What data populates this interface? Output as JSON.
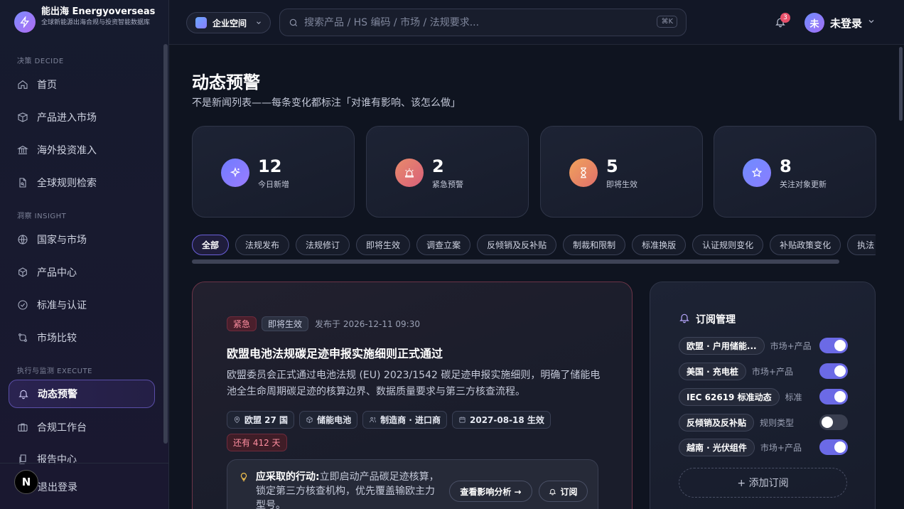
{
  "brand": {
    "name": "能出海 Energyoverseas",
    "subtitle": "全球新能源出海合规与投资智能数据库"
  },
  "sidebar": {
    "sections": [
      {
        "label": "决策 DECIDE"
      },
      {
        "label": "洞察 INSIGHT"
      },
      {
        "label": "执行与监测 EXECUTE"
      }
    ],
    "items": [
      {
        "label": "首页",
        "icon": "home-icon"
      },
      {
        "label": "产品进入市场",
        "icon": "box-icon"
      },
      {
        "label": "海外投资准入",
        "icon": "bank-icon"
      },
      {
        "label": "全球规则检索",
        "icon": "doc-search-icon"
      },
      {
        "label": "国家与市场",
        "icon": "globe-icon"
      },
      {
        "label": "产品中心",
        "icon": "cube-icon"
      },
      {
        "label": "标准与认证",
        "icon": "check-circle-icon"
      },
      {
        "label": "市场比较",
        "icon": "compare-icon"
      },
      {
        "label": "动态预警",
        "icon": "bell-icon",
        "active": true
      },
      {
        "label": "合规工作台",
        "icon": "briefcase-icon"
      },
      {
        "label": "报告中心",
        "icon": "report-icon"
      }
    ],
    "n_badge": "N",
    "logout": "退出登录"
  },
  "topbar": {
    "workspace": "企业空间",
    "search_placeholder": "搜索产品 / HS 编码 / 市场 / 法规要求...",
    "shortcut": "⌘K",
    "notifications": "3",
    "avatar": "未",
    "user": "未登录"
  },
  "page": {
    "title": "动态预警",
    "subtitle": "不是新闻列表——每条变化都标注「对谁有影响、该怎么做」"
  },
  "stats": [
    {
      "value": "12",
      "label": "今日新增",
      "color": "#6f7cff"
    },
    {
      "value": "2",
      "label": "紧急预警",
      "color": "#e0706b"
    },
    {
      "value": "5",
      "label": "即将生效",
      "color": "#e6885e"
    },
    {
      "value": "8",
      "label": "关注对象更新",
      "color": "#7083ff"
    }
  ],
  "filters": [
    "全部",
    "法规发布",
    "法规修订",
    "即将生效",
    "调查立案",
    "反倾销及反补贴",
    "制裁和限制",
    "标准换版",
    "认证规则变化",
    "补贴政策变化",
    "执法"
  ],
  "alert": {
    "tag_urgent": "紧急",
    "tag_soon": "即将生效",
    "published": "发布于 2026-12-11 09:30",
    "title": "欧盟电池法规碳足迹申报实施细则正式通过",
    "description": "欧盟委员会正式通过电池法规 (EU) 2023/1542 碳足迹申报实施细则，明确了储能电池全生命周期碳足迹的核算边界、数据质量要求与第三方核查流程。",
    "meta": {
      "region": "欧盟 27 国",
      "product": "储能电池",
      "party": "制造商 · 进口商",
      "effective": "2027-08-18 生效",
      "remaining": "还有 412 天"
    },
    "action_label": "应采取的行动:",
    "action_text": "立即启动产品碳足迹核算，锁定第三方核查机构，优先覆盖输欧主力型号。",
    "btn_analysis": "查看影响分析 →",
    "btn_subscribe": "订阅"
  },
  "subscriptions": {
    "title": "订阅管理",
    "items": [
      {
        "name": "欧盟 · 户用储能...",
        "type": "市场+产品",
        "on": true
      },
      {
        "name": "美国 · 充电桩",
        "type": "市场+产品",
        "on": true
      },
      {
        "name": "IEC 62619 标准动态",
        "type": "标准",
        "on": true
      },
      {
        "name": "反倾销及反补贴",
        "type": "规则类型",
        "on": false
      },
      {
        "name": "越南 · 光伏组件",
        "type": "市场+产品",
        "on": true
      }
    ],
    "add_label": "+ 添加订阅"
  }
}
